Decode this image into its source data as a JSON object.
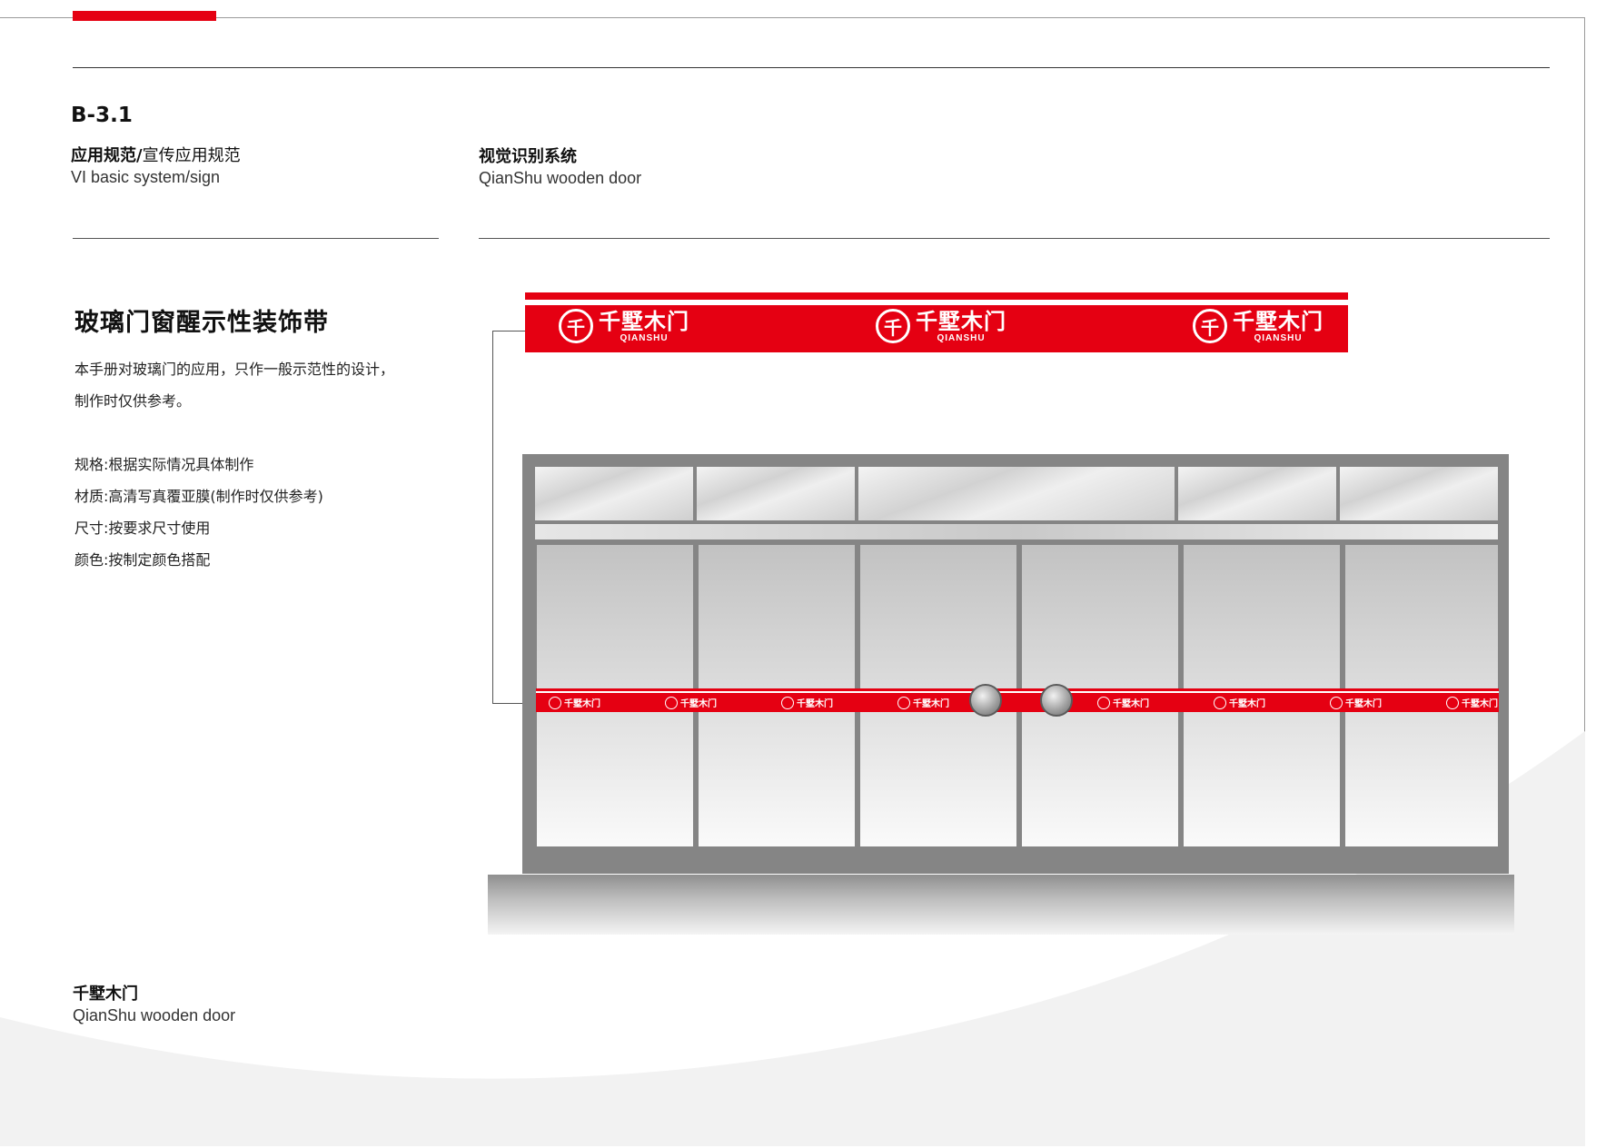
{
  "header": {
    "code": "B-3.1",
    "category_main": "应用规范/",
    "category_sub": "宣传应用规范",
    "category_en": "VI basic system/sign",
    "system_cn": "视觉识别系统",
    "system_en": "QianShu wooden door"
  },
  "content": {
    "title": "玻璃门窗醒示性装饰带",
    "intro_line1": "本手册对玻璃门的应用，只作一般示范性的设计，",
    "intro_line2": "制作时仅供参考。",
    "spec": "规格:根据实际情况具体制作",
    "material": "材质:高清写真覆亚膜(制作时仅供参考)",
    "size": "尺寸:按要求尺寸使用",
    "color": "颜色:按制定颜色搭配"
  },
  "logo": {
    "cn": "千墅木门",
    "en": "QIANSHU",
    "emblem_icon": "qianshu-emblem-icon"
  },
  "footer": {
    "brand_cn": "千墅木门",
    "brand_en": "QianShu wooden door"
  },
  "colors": {
    "brand_red": "#e50012",
    "frame_gray": "#858585"
  }
}
